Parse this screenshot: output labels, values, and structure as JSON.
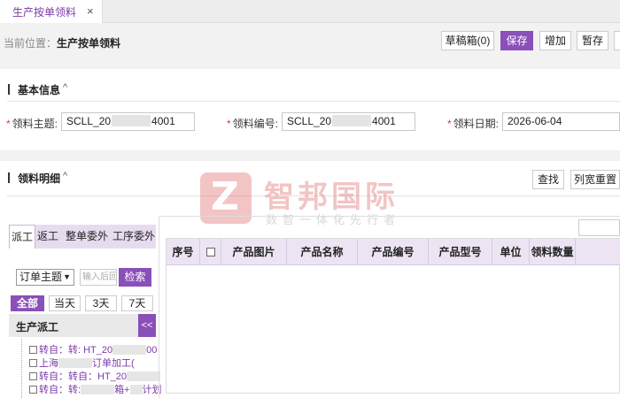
{
  "tab": {
    "label": "生产按单领料",
    "close": "×"
  },
  "location": {
    "prefix": "当前位置：",
    "current": "生产按单领料"
  },
  "toolbar": {
    "draft": "草稿箱(0)",
    "save": "保存",
    "add": "增加",
    "temp_save": "暂存"
  },
  "basic_info": {
    "title": "基本信息",
    "chevron": "^",
    "fields": [
      {
        "label": "领料主题:",
        "value_prefix": "SCLL_20",
        "value_suffix": "4001"
      },
      {
        "label": "领料编号:",
        "value_prefix": "SCLL_20",
        "value_suffix": "4001"
      },
      {
        "label": "领料日期:",
        "value": "2026-06-04"
      }
    ],
    "required_mark": "*"
  },
  "detail": {
    "title": "领料明细",
    "chevron": "^",
    "find_button": "查找",
    "reset_width_button": "列宽重置"
  },
  "watermark": {
    "logo_letter": "Z",
    "title": "智邦国际",
    "subtitle": "数智一体化先行者"
  },
  "side_panel": {
    "tabs": [
      "派工",
      "返工",
      "整单委外",
      "工序委外"
    ],
    "active_tab": "派工",
    "filter_select": "订单主题",
    "keyword_placeholder": "输入后回",
    "search_button": "检索",
    "date_filters": [
      "全部",
      "当天",
      "3天",
      "7天"
    ],
    "tree_title": "生产派工",
    "collapse_label": "<<",
    "tree_items": [
      {
        "a": "转自：转: HT_20",
        "b": "00"
      },
      {
        "a": "上海",
        "b": "订单加工("
      },
      {
        "a": "转自：转自：HT_20",
        "b": ""
      },
      {
        "a": "转自：转:",
        "b": "箱+",
        "c": "计划"
      }
    ]
  },
  "grid": {
    "columns": [
      "序号",
      "",
      "产品图片",
      "产品名称",
      "产品编号",
      "产品型号",
      "单位",
      "领料数量"
    ]
  }
}
